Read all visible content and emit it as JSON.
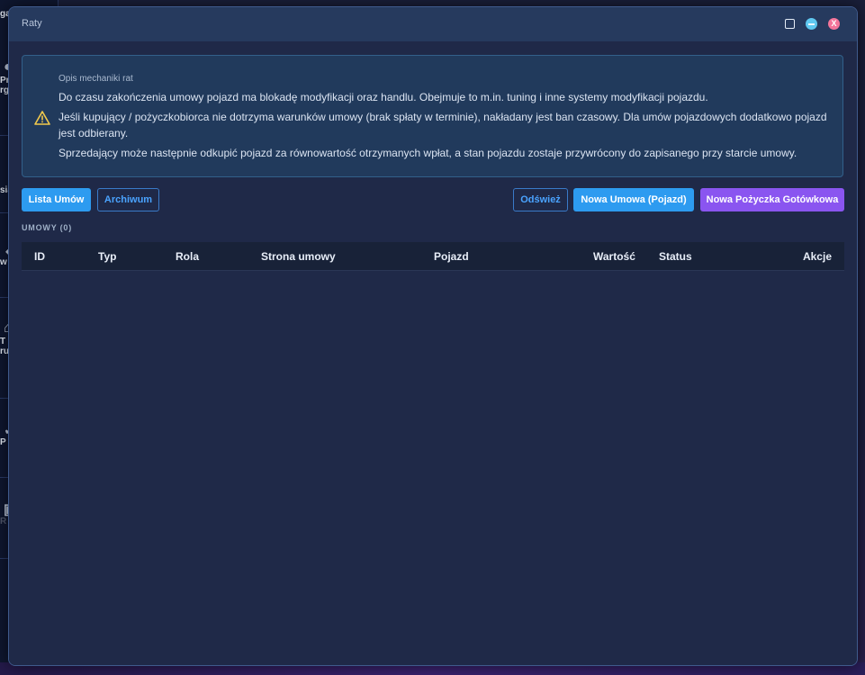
{
  "background": {
    "sidebar_items": [
      {
        "label": "ga",
        "icon": "user-icon"
      },
      {
        "label": "Pr",
        "icon": "user-icon"
      },
      {
        "label": "rg",
        "icon": ""
      },
      {
        "label": "sia",
        "icon": ""
      },
      {
        "label": "w",
        "icon": "arrow-icon"
      },
      {
        "label": "T",
        "icon": "house-icon"
      },
      {
        "label": "ru",
        "icon": ""
      },
      {
        "label": "P",
        "icon": "chart-icon"
      },
      {
        "label": "R",
        "icon": "wallet-icon"
      }
    ]
  },
  "window": {
    "title": "Raty",
    "controls": {
      "maximize": "maximize-icon",
      "minimize": "minimize-icon",
      "close": "X"
    }
  },
  "info": {
    "title": "Opis mechaniki rat",
    "lines": [
      "Do czasu zakończenia umowy pojazd ma blokadę modyfikacji oraz handlu. Obejmuje to m.in. tuning i inne systemy modyfikacji pojazdu.",
      "Jeśli kupujący / pożyczkobiorca nie dotrzyma warunków umowy (brak spłaty w terminie), nakładany jest ban czasowy. Dla umów pojazdowych dodatkowo pojazd jest odbierany.",
      "Sprzedający może następnie odkupić pojazd za równowartość otrzymanych wpłat, a stan pojazdu zostaje przywrócony do zapisanego przy starcie umowy."
    ],
    "icon": "warning-icon"
  },
  "toolbar": {
    "list_label": "Lista Umów",
    "archive_label": "Archiwum",
    "refresh_label": "Odśwież",
    "new_vehicle_label": "Nowa Umowa (Pojazd)",
    "new_loan_label": "Nowa Pożyczka Gotówkowa"
  },
  "section_label": "UMOWY (0)",
  "table": {
    "columns": [
      "ID",
      "Typ",
      "Rola",
      "Strona umowy",
      "Pojazd",
      "Wartość",
      "Status",
      "Akcje"
    ],
    "rows": []
  },
  "colors": {
    "accent": "#2d9bf0",
    "purple": "#8a55f0",
    "warning": "#f2c94c",
    "close": "#f4759a",
    "minimize": "#5fc8f0"
  }
}
